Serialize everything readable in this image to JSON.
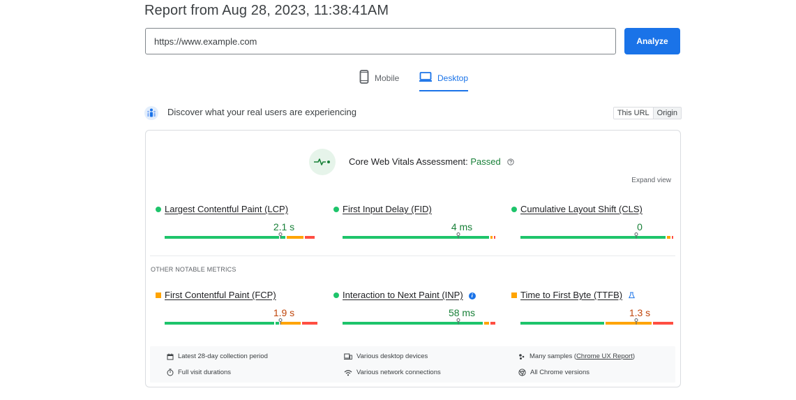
{
  "report": {
    "title": "Report from Aug 28, 2023, 11:38:41AM"
  },
  "search": {
    "value": "https://www.example.com",
    "analyze_label": "Analyze"
  },
  "tabs": [
    {
      "label": "Mobile",
      "icon": "smartphone-icon",
      "selected": false
    },
    {
      "label": "Desktop",
      "icon": "laptop-icon",
      "selected": true
    }
  ],
  "crux": {
    "heading": "Discover what your real users are experiencing",
    "icon": "users-icon",
    "scope": {
      "this_url": "This URL",
      "origin": "Origin",
      "selected": "Origin"
    }
  },
  "assessment": {
    "label": "Core Web Vitals Assessment: ",
    "status": "Passed",
    "expand_view": "Expand view",
    "icon": "vitals-pulse-icon"
  },
  "core_metrics": [
    {
      "name": "Largest Contentful Paint (LCP)",
      "value": "2.1 s",
      "rating": "good",
      "distribution": [
        0.75,
        0.04,
        0.12,
        0.07
      ],
      "marker": 0.75
    },
    {
      "name": "First Input Delay (FID)",
      "value": "4 ms",
      "rating": "good",
      "distribution": [
        0.96,
        0.02,
        0.02
      ],
      "marker": 0.75
    },
    {
      "name": "Cumulative Layout Shift (CLS)",
      "value": "0",
      "rating": "good",
      "distribution": [
        0.95,
        0.03,
        0.02
      ],
      "marker": 0.75
    }
  ],
  "other_label": "Other notable metrics",
  "other_metrics": [
    {
      "name": "First Contentful Paint (FCP)",
      "value": "1.9 s",
      "rating": "avg",
      "distribution": [
        0.72,
        0.03,
        0.14,
        0.11
      ],
      "marker": 0.75,
      "extra_icon": null
    },
    {
      "name": "Interaction to Next Paint (INP)",
      "value": "58 ms",
      "rating": "good",
      "distribution": [
        0.92,
        0.04,
        0.04
      ],
      "marker": 0.75,
      "extra_icon": "info-icon"
    },
    {
      "name": "Time to First Byte (TTFB)",
      "value": "1.3 s",
      "rating": "avg",
      "distribution": [
        0.55,
        0.31,
        0.14
      ],
      "marker": 0.75,
      "extra_icon": "flask-icon"
    }
  ],
  "footer": {
    "period": "Latest 28-day collection period",
    "devices": "Various desktop devices",
    "samples_prefix": "Many samples (",
    "samples_link": "Chrome UX Report",
    "samples_suffix": ")",
    "durations": "Full visit durations",
    "connections": "Various network connections",
    "versions": "All Chrome versions"
  },
  "colors": {
    "good": "#1ec46b",
    "avg": "#ffa400",
    "poor": "#ff4e42",
    "accent": "#1a73e8"
  }
}
